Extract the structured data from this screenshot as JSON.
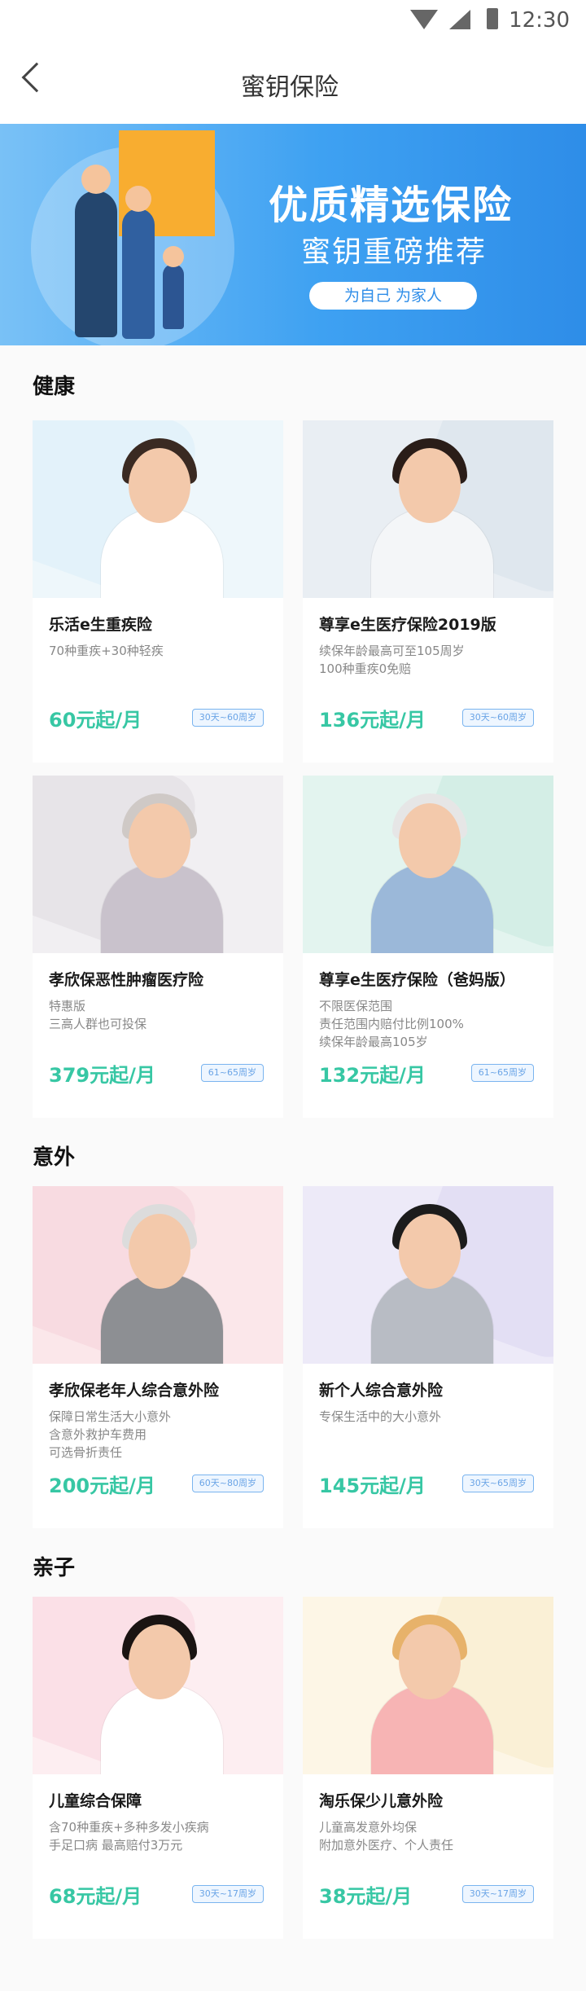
{
  "status": {
    "time": "12:30"
  },
  "appbar": {
    "title": "蜜钥保险"
  },
  "banner": {
    "title": "优质精选保险",
    "subtitle": "蜜钥重磅推荐",
    "pill": "为自己 为家人"
  },
  "sections": [
    {
      "title": "健康",
      "cards": [
        {
          "name": "乐活e生重疾险",
          "desc": [
            "70种重疾+30种轻疾"
          ],
          "price": "60元起/月",
          "tag": "30天~60周岁",
          "bg": "#eef7fb",
          "blob": "#dbeff9",
          "shirt": "#ffffff",
          "hair": "#3a2a22"
        },
        {
          "name": "尊享e生医疗保险2019版",
          "desc": [
            "续保年龄最高可至105周岁",
            "100种重疾0免赔"
          ],
          "price": "136元起/月",
          "tag": "30天~60周岁",
          "bg": "#e9eef3",
          "blob": "#d7e1ea",
          "shirt": "#f4f6f8",
          "hair": "#2a1d18"
        }
      ]
    },
    {
      "title": "",
      "cards": [
        {
          "name": "孝欣保恶性肿瘤医疗险",
          "desc": [
            "特惠版",
            "三高人群也可投保"
          ],
          "price": "379元起/月",
          "tag": "61~65周岁",
          "bg": "#f1eff2",
          "blob": "#dedbe0",
          "shirt": "#c9c2cc",
          "hair": "#cfc9c6"
        },
        {
          "name": "尊享e生医疗保险（爸妈版）",
          "desc": [
            "不限医保范围",
            "责任范围内赔付比例100%",
            "续保年龄最高105岁"
          ],
          "price": "132元起/月",
          "tag": "61~65周岁",
          "bg": "#e3f4ef",
          "blob": "#c9eadf",
          "shirt": "#9bb8d9",
          "hair": "#e6e6e6"
        }
      ]
    },
    {
      "title": "意外",
      "cards": [
        {
          "name": "孝欣保老年人综合意外险",
          "desc": [
            "保障日常生活大小意外",
            "含意外救护车费用",
            "可选骨折责任"
          ],
          "price": "200元起/月",
          "tag": "60天~80周岁",
          "bg": "#fbe7ea",
          "blob": "#f6d2d8",
          "shirt": "#8d8f93",
          "hair": "#dcdcdc"
        },
        {
          "name": "新个人综合意外险",
          "desc": [
            "专保生活中的大小意外"
          ],
          "price": "145元起/月",
          "tag": "30天~65周岁",
          "bg": "#edeaf8",
          "blob": "#dad5f0",
          "shirt": "#b8bcc4",
          "hair": "#1c1c1c"
        }
      ]
    },
    {
      "title": "亲子",
      "cards": [
        {
          "name": "儿童综合保障",
          "desc": [
            "含70种重疾+多种多发小疾病",
            "手足口病 最高赔付3万元"
          ],
          "price": "68元起/月",
          "tag": "30天~17周岁",
          "bg": "#fdeef1",
          "blob": "#f9d6de",
          "shirt": "#ffffff",
          "hair": "#1a1412"
        },
        {
          "name": "淘乐保少儿意外险",
          "desc": [
            "儿童高发意外均保",
            "附加意外医疗、个人责任"
          ],
          "price": "38元起/月",
          "tag": "30天~17周岁",
          "bg": "#fdf6e6",
          "blob": "#f8ebc9",
          "shirt": "#f7b4b4",
          "hair": "#e7b26a"
        }
      ]
    }
  ]
}
